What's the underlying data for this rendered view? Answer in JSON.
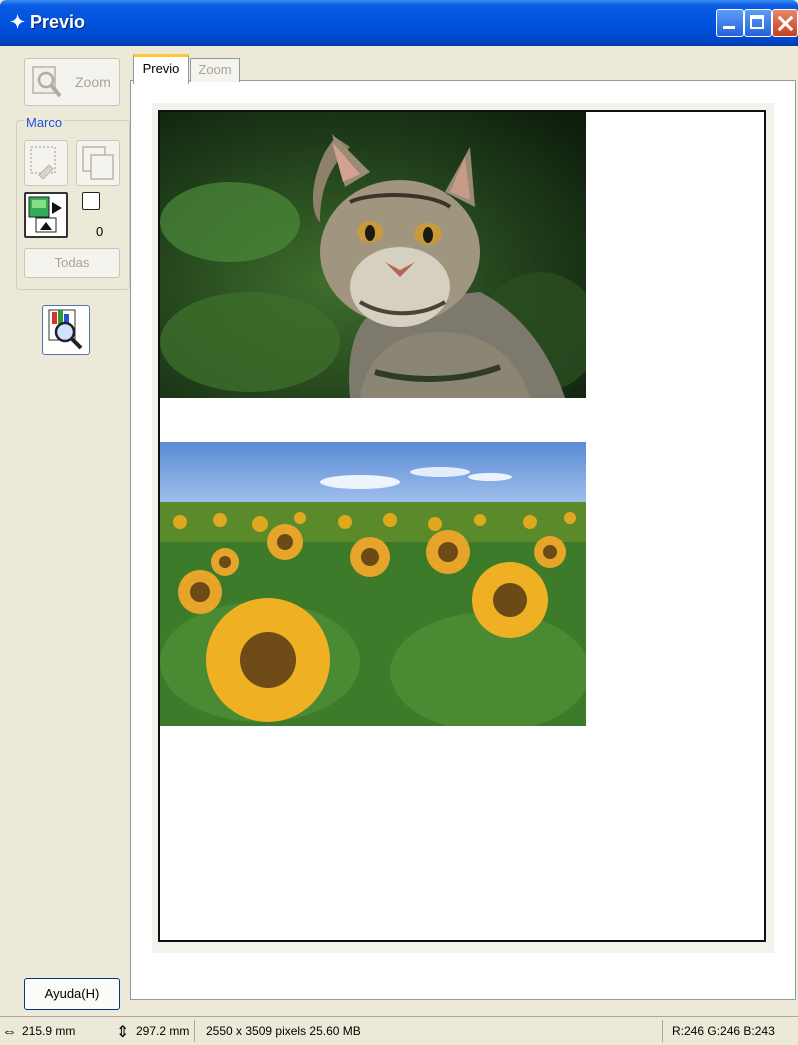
{
  "window": {
    "title": "Previo",
    "title_icon": "epson-scan-icon",
    "controls": [
      "minimize-icon",
      "maximize-icon",
      "close-icon"
    ],
    "colors": {
      "titlebar": "#0053e1",
      "close": "#c7401f"
    }
  },
  "left_panel": {
    "zoom_label": "Zoom",
    "marco": {
      "label": "Marco",
      "frame_count": "0",
      "todas_label": "Todas"
    },
    "help_label": "Ayuda(H)"
  },
  "tabs": [
    {
      "label": "Previo",
      "active": true
    },
    {
      "label": "Zoom",
      "active": false
    }
  ],
  "preview": {
    "images": [
      "cat-photo",
      "sunflower-field-photo"
    ]
  },
  "statusbar": {
    "width": "215.9 mm",
    "height": "297.2 mm",
    "pixels": "2550 x 3509 pixels 25.60 MB",
    "rgb": "R:246 G:246 B:243"
  }
}
